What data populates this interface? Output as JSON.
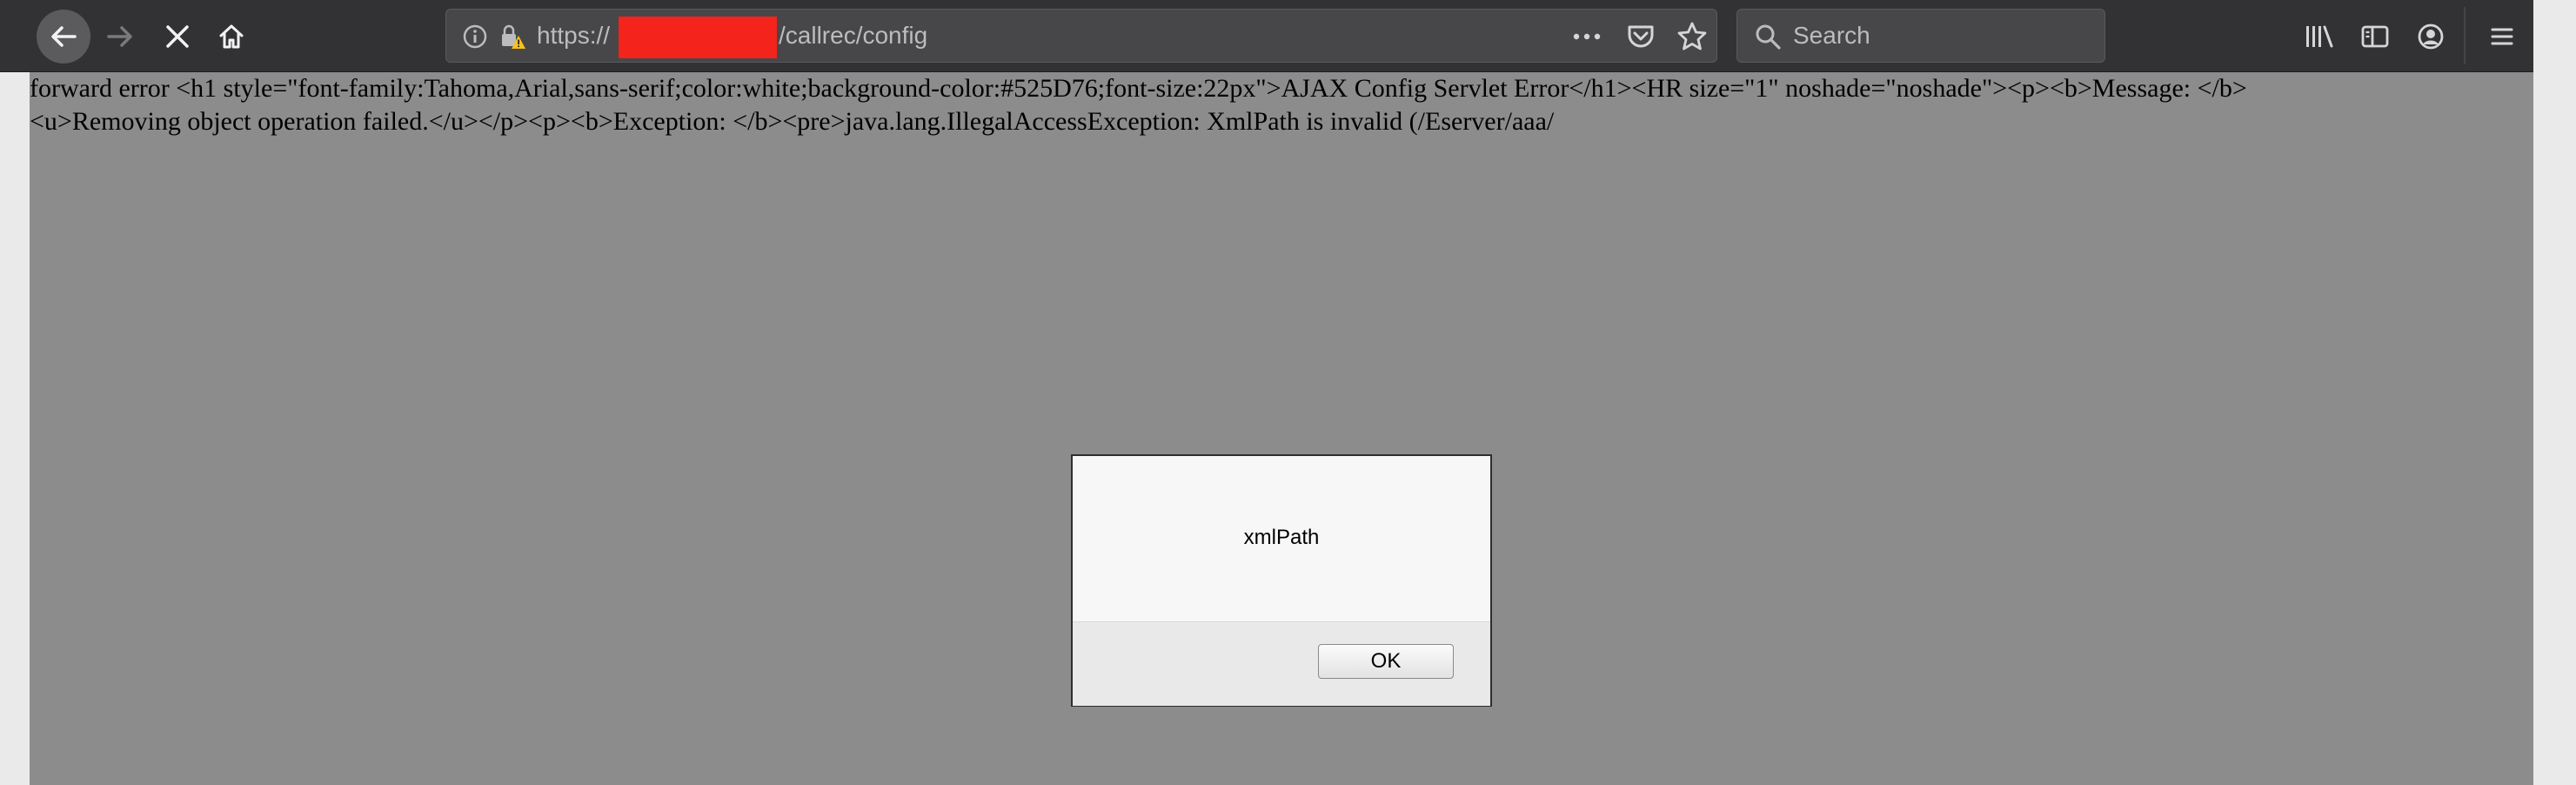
{
  "toolbar": {
    "icons": {
      "back": "back-arrow-icon",
      "forward": "forward-arrow-icon",
      "stop": "stop-icon",
      "home": "home-icon",
      "info": "info-icon",
      "lock_warning": "lock-warning-icon",
      "more": "more-icon",
      "pocket": "pocket-icon",
      "bookmark": "star-icon",
      "search": "search-icon",
      "library": "library-icon",
      "sidebar": "sidebar-icon",
      "account": "account-icon",
      "menu": "hamburger-menu-icon"
    },
    "url": {
      "prefix": "https://",
      "path": "/callrec/config",
      "redaction_color": "#f4231b"
    },
    "search": {
      "placeholder": "Search"
    }
  },
  "page": {
    "error_text": "forward error <h1 style=\"font-family:Tahoma,Arial,sans-serif;color:white;background-color:#525D76;font-size:22px\">AJAX Config Servlet Error</h1><HR size=\"1\" noshade=\"noshade\"><p><b>Message: </b><u>Removing object operation failed.</u></p><p><b>Exception: </b><pre>java.lang.IllegalAccessException: XmlPath is invalid (/Eserver/aaa/",
    "background_color": "#8c8c8c"
  },
  "dialog": {
    "message": "xmlPath",
    "ok_label": "OK"
  }
}
